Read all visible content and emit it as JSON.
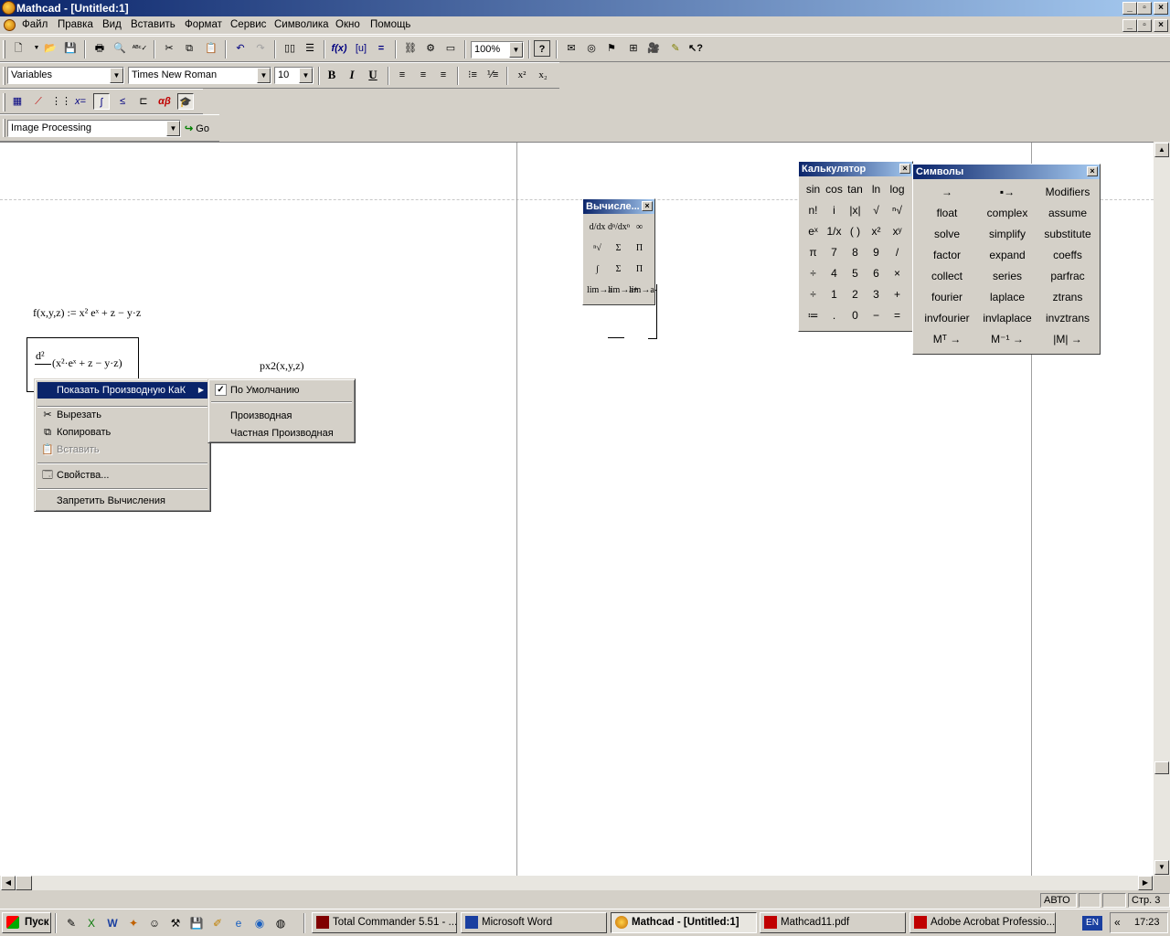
{
  "window": {
    "title": "Mathcad - [Untitled:1]"
  },
  "menu": [
    "Файл",
    "Правка",
    "Вид",
    "Вставить",
    "Формат",
    "Сервис",
    "Символика",
    "Окно",
    "Помощь"
  ],
  "toolbar": {
    "zoom": "100%",
    "style": "Variables",
    "font": "Times New Roman",
    "size": "10",
    "bold": "B",
    "italic": "I",
    "underline": "U",
    "superscript": "x²",
    "subscript": "x₂",
    "resource": "Image Processing",
    "go": "Go"
  },
  "document": {
    "func_def_lhs": "f(x,y,z) :=",
    "func_def_rhs": "x² eˣ + z − y·z",
    "deriv_num": "d²",
    "deriv_expr": "(x²·eˣ + z − y·z)",
    "px2": "px2(x,y,z)"
  },
  "context_menu": {
    "items": [
      "Показать Производную КаК",
      "Вырезать",
      "Копировать",
      "Вставить",
      "Свойства...",
      "Запретить Вычисления"
    ]
  },
  "submenu": {
    "items": [
      "По Умолчанию",
      "Производная",
      "Частная Производная"
    ]
  },
  "eval_palette": {
    "title": "Вычисле...",
    "rows": [
      [
        "d/dx",
        "dⁿ/dxⁿ",
        "∞"
      ],
      [
        "ⁿ√",
        "Σ",
        "Π"
      ],
      [
        "∫",
        "Σ",
        "Π"
      ],
      [
        "lim→a",
        "lim→a+",
        "lim→a-"
      ]
    ]
  },
  "calc_palette": {
    "title": "Калькулятор",
    "rows": [
      [
        "sin",
        "cos",
        "tan",
        "ln",
        "log"
      ],
      [
        "n!",
        "i",
        "|x|",
        "√",
        "ⁿ√"
      ],
      [
        "eˣ",
        "1/x",
        "( )",
        "x²",
        "xʸ"
      ],
      [
        "π",
        "7",
        "8",
        "9",
        "/"
      ],
      [
        "÷",
        "4",
        "5",
        "6",
        "×"
      ],
      [
        "÷",
        "1",
        "2",
        "3",
        "+"
      ],
      [
        "≔",
        ".",
        "0",
        "−",
        "="
      ]
    ]
  },
  "sym_palette": {
    "title": "Символы",
    "rows": [
      [
        "→",
        "▪→",
        "Modifiers"
      ],
      [
        "float",
        "complex",
        "assume"
      ],
      [
        "solve",
        "simplify",
        "substitute"
      ],
      [
        "factor",
        "expand",
        "coeffs"
      ],
      [
        "collect",
        "series",
        "parfrac"
      ],
      [
        "fourier",
        "laplace",
        "ztrans"
      ],
      [
        "invfourier",
        "invlaplace",
        "invztrans"
      ],
      [
        "Mᵀ →",
        "M⁻¹ →",
        "|M| →"
      ]
    ]
  },
  "statusbar": {
    "mode": "АВТО",
    "page": "Стр. 3"
  },
  "taskbar": {
    "start": "Пуск",
    "tasks": [
      "Total Commander 5.51 - ...",
      "Microsoft Word",
      "Mathcad - [Untitled:1]",
      "Mathcad11.pdf",
      "Adobe Acrobat Professio..."
    ],
    "lang": "EN",
    "clock": "17:23"
  }
}
